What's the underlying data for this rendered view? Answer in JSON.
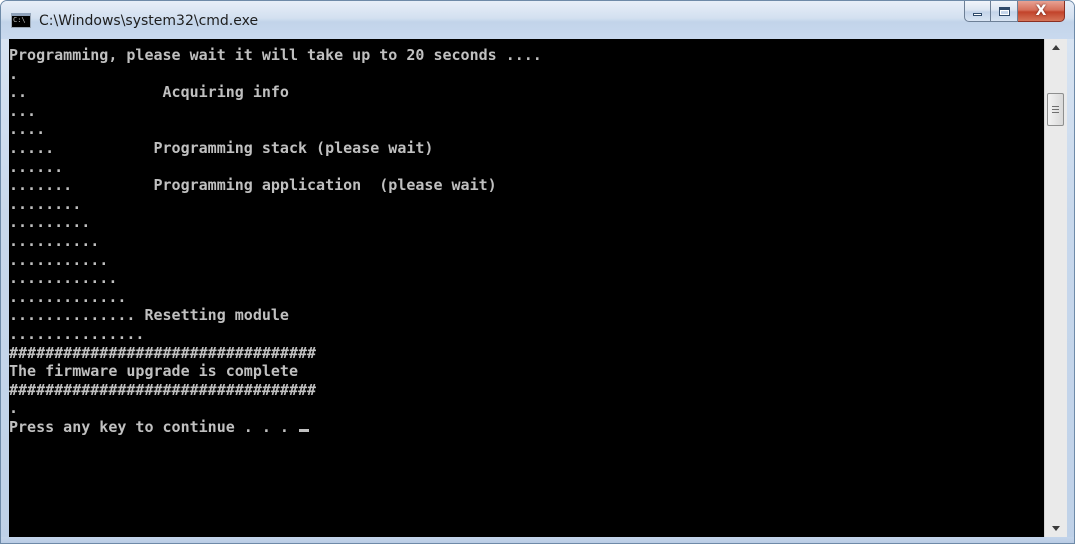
{
  "window": {
    "title": "C:\\Windows\\system32\\cmd.exe",
    "icon": "cmd-icon",
    "icon_label": "C:\\"
  },
  "caption": {
    "minimize_icon": "minimize-icon",
    "maximize_icon": "maximize-icon",
    "close_icon": "close-icon",
    "close_glyph": "X"
  },
  "colors": {
    "console_bg": "#000000",
    "console_text": "#c0c0c0",
    "close_button": "#c2432a"
  },
  "console": {
    "lines": [
      "Programming, please wait it will take up to 20 seconds ....",
      ".",
      "..               Acquiring info",
      "...",
      "....",
      ".....           Programming stack (please wait)",
      "......",
      ".......         Programming application  (please wait)",
      "........",
      ".........",
      "..........",
      "...........",
      "............",
      ".............",
      ".............. Resetting module",
      "...............",
      "##################################",
      "The firmware upgrade is complete",
      "##################################",
      ".",
      "Press any key to continue . . . "
    ]
  }
}
